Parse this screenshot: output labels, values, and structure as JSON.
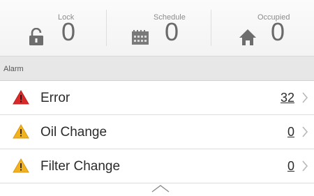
{
  "stats": {
    "lock": {
      "label": "Lock",
      "value": "0"
    },
    "schedule": {
      "label": "Schedule",
      "value": "0"
    },
    "occupied": {
      "label": "Occupied",
      "value": "0"
    }
  },
  "alarm": {
    "header": "Alarm",
    "items": [
      {
        "label": "Error",
        "count": "32",
        "icon": "warning-red-icon",
        "color": "#d92a2a"
      },
      {
        "label": "Oil Change",
        "count": "0",
        "icon": "warning-yellow-icon",
        "color": "#f0b21f"
      },
      {
        "label": "Filter Change",
        "count": "0",
        "icon": "warning-yellow-icon",
        "color": "#f0b21f"
      }
    ]
  }
}
